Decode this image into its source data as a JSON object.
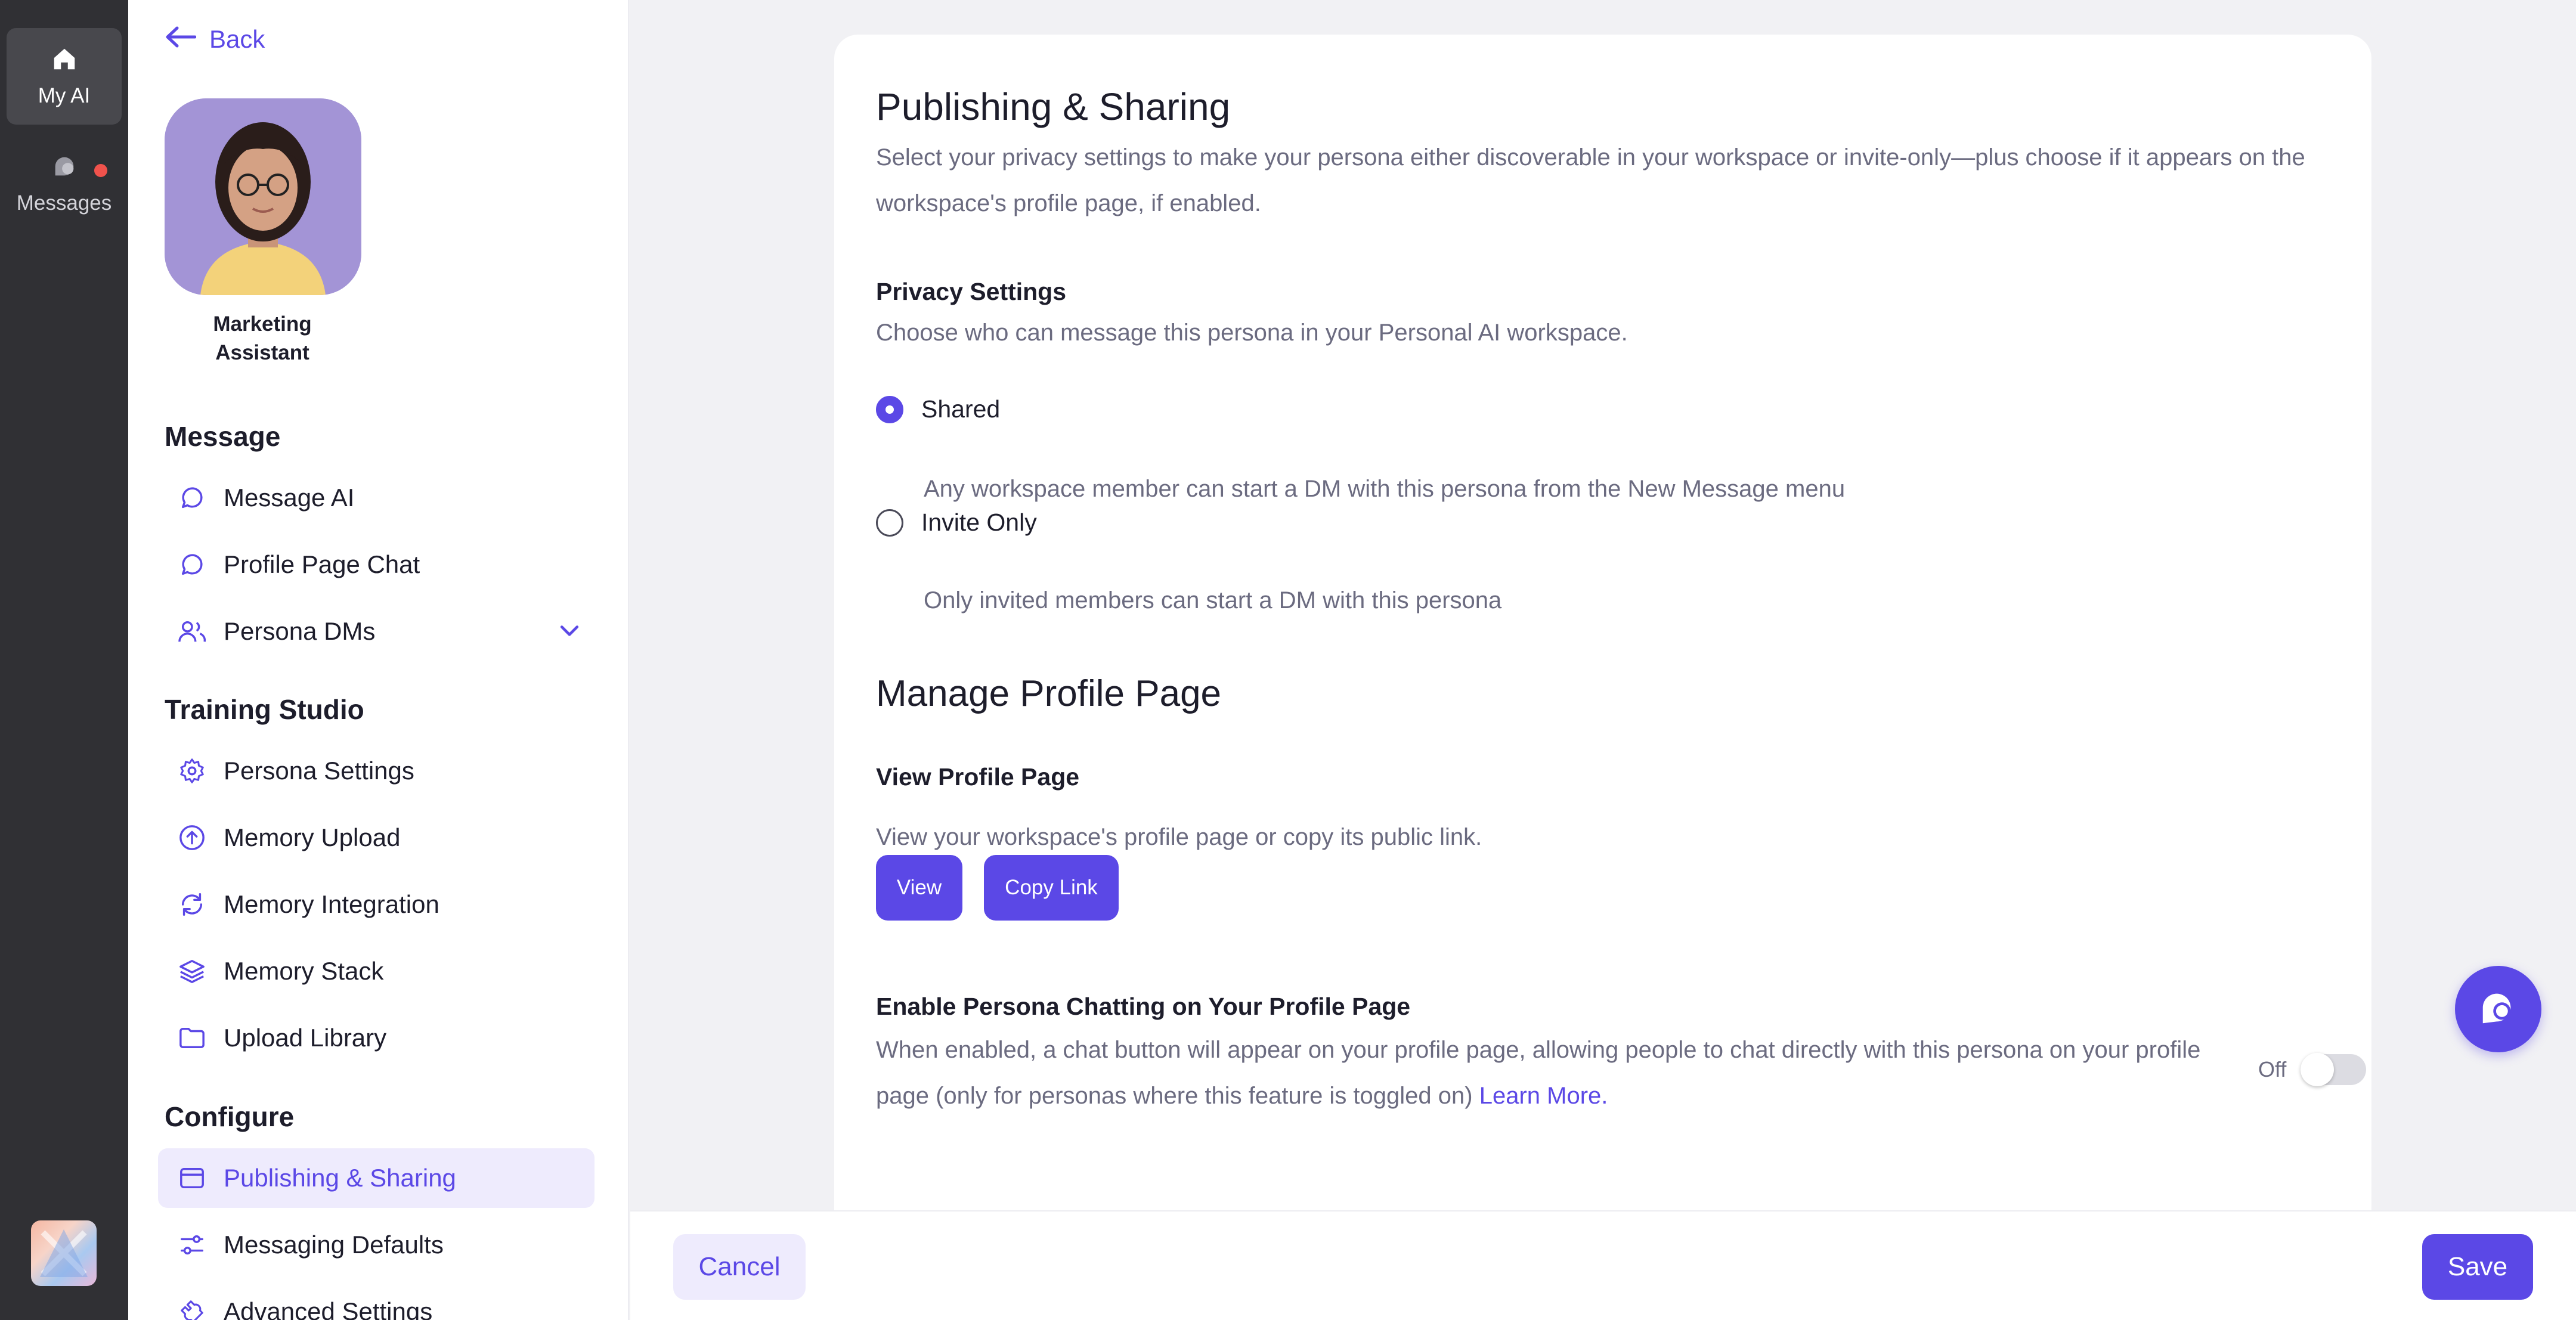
{
  "rail": {
    "items": [
      {
        "label": "My AI",
        "icon": "home-icon",
        "active": true
      },
      {
        "label": "Messages",
        "icon": "messages-icon",
        "badge": true
      }
    ]
  },
  "nav": {
    "back_label": "Back",
    "persona_name": "Marketing Assistant",
    "sections": {
      "message": "Message",
      "training": "Training Studio",
      "configure": "Configure"
    },
    "message_items": [
      "Message AI",
      "Profile Page Chat",
      "Persona DMs"
    ],
    "training_items": [
      "Persona Settings",
      "Memory Upload",
      "Memory Integration",
      "Memory Stack",
      "Upload Library"
    ],
    "configure_items": [
      "Publishing & Sharing",
      "Messaging Defaults",
      "Advanced Settings"
    ],
    "active_item": "Publishing & Sharing"
  },
  "content": {
    "title": "Publishing & Sharing",
    "description": "Select your privacy settings to make your persona either discoverable in your workspace or invite-only—plus choose if it appears on the workspace's profile page, if enabled.",
    "privacy": {
      "heading": "Privacy Settings",
      "subtitle": "Choose who can message this persona in your Personal AI workspace.",
      "options": [
        {
          "label": "Shared",
          "desc": "Any workspace member can start a DM with this persona from the New Message menu",
          "selected": true
        },
        {
          "label": "Invite Only",
          "desc": "Only invited members can start a DM with this persona",
          "selected": false
        }
      ]
    },
    "profile": {
      "heading": "Manage Profile Page",
      "view_heading": "View Profile Page",
      "view_desc": "View your workspace's profile page or copy its public link.",
      "view_button": "View",
      "copy_button": "Copy Link",
      "chat_heading": "Enable Persona Chatting on Your Profile Page",
      "chat_desc": "When enabled, a chat button will appear on your profile page, allowing people to chat directly with this persona on your profile page (only for personas where this feature is toggled on)",
      "learn_more": "Learn More.",
      "toggle_label": "Off",
      "toggle_on": false
    }
  },
  "footer": {
    "cancel": "Cancel",
    "save": "Save"
  },
  "colors": {
    "accent": "#5b48e6",
    "rail_bg": "#303034",
    "page_bg": "#f1f1f4"
  }
}
